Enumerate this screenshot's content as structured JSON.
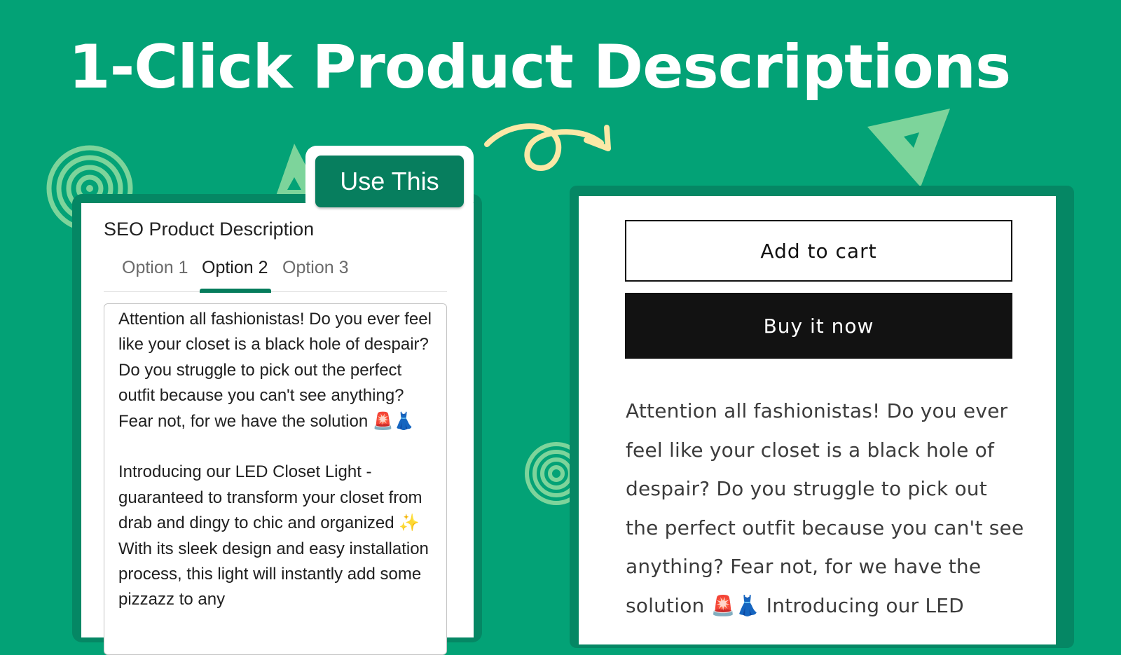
{
  "headline": "1-Click Product Descriptions",
  "colors": {
    "background": "#03a276",
    "frame": "#058764",
    "accent_button": "#077e5e",
    "decoration": "#7dd49b",
    "arrow": "#fbe8a6"
  },
  "generator_panel": {
    "title": "SEO Product Description",
    "use_button_label": "Use This",
    "tabs": [
      {
        "label": "Option 1",
        "active": false
      },
      {
        "label": "Option 2",
        "active": true
      },
      {
        "label": "Option 3",
        "active": false
      }
    ],
    "description_paragraph_1": "Attention all fashionistas! Do you ever feel like your closet is a black hole of despair? Do you struggle to pick out the perfect outfit because you can't see anything? Fear not, for we have the solution 🚨👗",
    "description_paragraph_2": "Introducing our LED Closet Light - guaranteed to transform your closet from drab and dingy to chic and organized ✨ With its sleek design and easy installation process, this light will instantly add some pizzazz to any"
  },
  "storefront_panel": {
    "add_to_cart_label": "Add to cart",
    "buy_now_label": "Buy it now",
    "description": "Attention all fashionistas! Do you ever feel like your closet is a black hole of despair? Do you struggle to pick out the perfect outfit because you can't see anything? Fear not, for we have the solution 🚨👗 Introducing our LED"
  },
  "decorations": {
    "arrow": "curly-arrow-icon",
    "spirals": [
      "concentric-circles-icon",
      "concentric-circles-icon"
    ],
    "triangles": [
      "triangle-outline-icon",
      "triangle-outline-icon"
    ]
  }
}
